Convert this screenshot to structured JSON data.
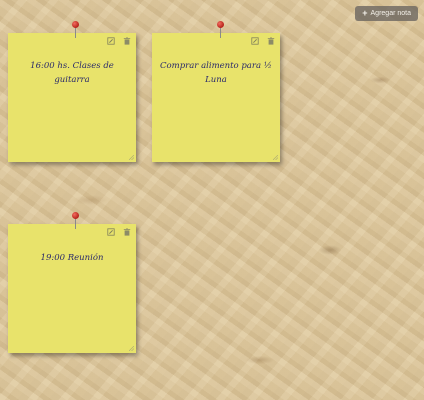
{
  "toolbar": {
    "add_note_label": "Agregar nota",
    "add_note_icon": "plus-icon"
  },
  "notes": [
    {
      "text": "16:00 hs. Clases de guitarra"
    },
    {
      "text": "Comprar alimento para ½ Luna"
    },
    {
      "text": "19:00 Reunión"
    }
  ],
  "note_icons": {
    "edit": "edit-icon",
    "delete": "trash-icon",
    "pin": "pushpin-icon"
  },
  "colors": {
    "note": "#e8e36b",
    "ink": "#2a2a6a",
    "pin": "#c0392b",
    "button": "#69645f"
  }
}
